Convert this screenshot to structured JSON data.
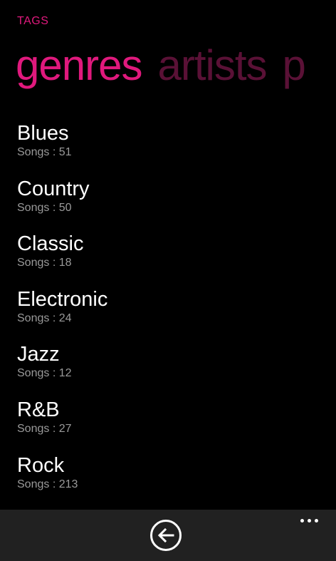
{
  "app": {
    "title": "TAGS",
    "accent_color": "#E0197D"
  },
  "pivot": {
    "items": [
      {
        "label": "genres",
        "active": true
      },
      {
        "label": "artists",
        "active": false
      },
      {
        "label": "p",
        "active": false
      }
    ]
  },
  "genres": {
    "count_label": "Songs",
    "items": [
      {
        "name": "Blues",
        "songs": "51"
      },
      {
        "name": "Country",
        "songs": "50"
      },
      {
        "name": "Classic",
        "songs": "18"
      },
      {
        "name": "Electronic",
        "songs": "24"
      },
      {
        "name": "Jazz",
        "songs": "12"
      },
      {
        "name": "R&B",
        "songs": "27"
      },
      {
        "name": "Rock",
        "songs": "213"
      }
    ]
  },
  "app_bar": {
    "back_icon": "back-arrow-icon",
    "more_icon": "ellipsis-icon"
  }
}
